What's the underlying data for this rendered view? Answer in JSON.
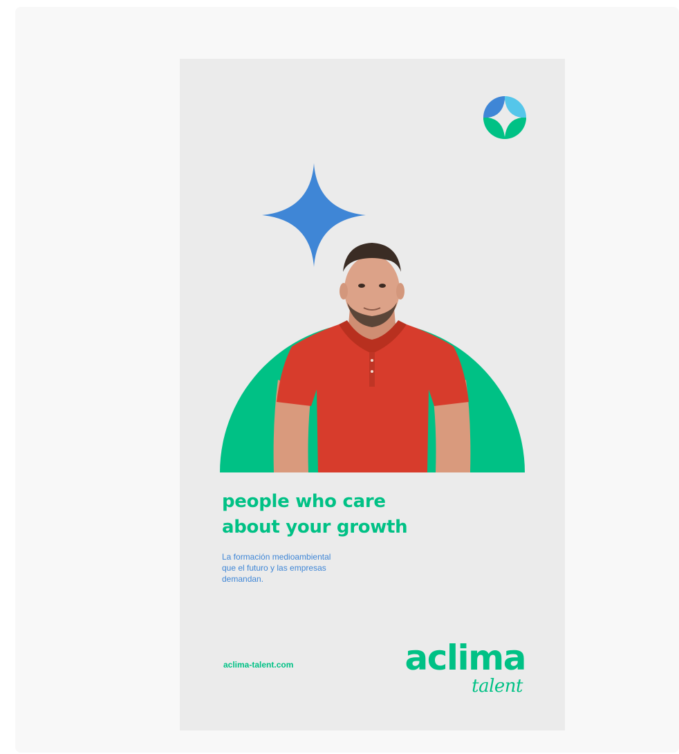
{
  "poster": {
    "headline_line1": "people who care",
    "headline_line2": "about your growth",
    "sub_line1": "La formación medioambiental",
    "sub_line2": "que el futuro y las empresas",
    "sub_line3": "demandan.",
    "website": "aclima-talent.com",
    "brand_name": "aclima",
    "brand_tagline": "talent"
  },
  "icons": {
    "badge": "four-point-star-badge-icon",
    "sparkle": "four-point-sparkle-icon"
  },
  "colors": {
    "brand_green": "#00c185",
    "accent_blue": "#3f86d6",
    "light_blue": "#55c6ea",
    "poster_bg": "#ebebeb",
    "shirt_red": "#d73c2c"
  }
}
